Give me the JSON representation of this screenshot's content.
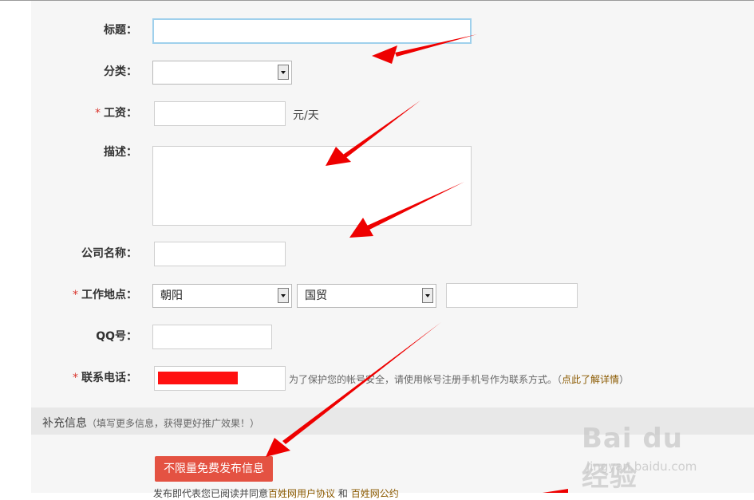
{
  "form": {
    "title_label": "标题：",
    "category_label": "分类：",
    "salary_label": "工资：",
    "salary_unit": "元/天",
    "description_label": "描述：",
    "company_label": "公司名称：",
    "location_label": "工作地点：",
    "location_district": "朝阳",
    "location_area": "国贸",
    "qq_label": "QQ号：",
    "phone_label": "联系电话：",
    "phone_hint": "为了保护您的帐号安全，请使用帐号注册手机号作为联系方式。（",
    "phone_hint_link": "点此了解详情",
    "phone_hint_end": "）",
    "required_mark": "*"
  },
  "section": {
    "title": "补充信息",
    "subtitle": "（填写更多信息，获得更好推广效果！）"
  },
  "actions": {
    "publish_label": "不限量免费发布信息"
  },
  "footer": {
    "agree_prefix": "发布即代表您已阅读并同意",
    "agree_link1": "百姓网用户协议",
    "agree_and": "和",
    "agree_link2": "百姓网公约"
  },
  "watermark": {
    "logo": "Bai du 经验",
    "url": "jingyan.baidu.com"
  },
  "colors": {
    "annotation_arrow": "#ee0000",
    "publish_button": "#e45242",
    "required": "#d9342c"
  }
}
